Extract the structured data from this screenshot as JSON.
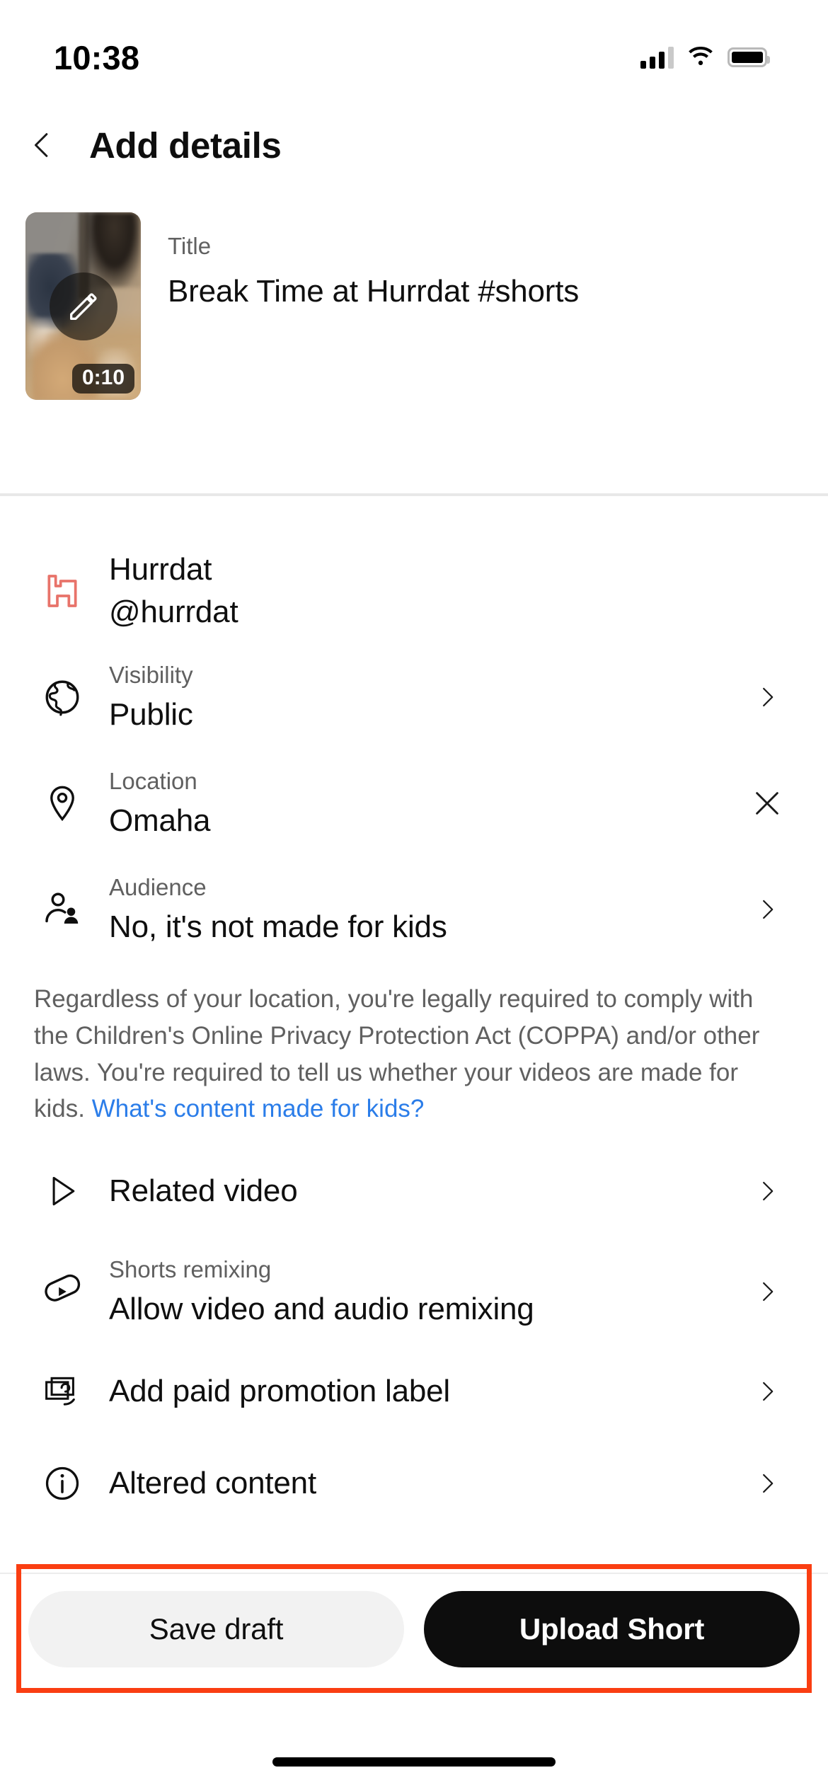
{
  "status_bar": {
    "time": "10:38",
    "signal_icon": "cellular-bars-icon",
    "wifi_icon": "wifi-icon",
    "battery_icon": "battery-icon"
  },
  "header": {
    "back_icon": "back-chevron-icon",
    "title": "Add details"
  },
  "video": {
    "edit_icon": "pencil-edit-icon",
    "duration": "0:10",
    "title_label": "Title",
    "title_value": "Break Time at Hurrdat #shorts"
  },
  "channel": {
    "avatar_icon": "hurrdat-h-logo-icon",
    "name": "Hurrdat",
    "handle": "@hurrdat",
    "brand_color": "#e8736a"
  },
  "rows": {
    "visibility": {
      "icon": "globe-icon",
      "label": "Visibility",
      "value": "Public",
      "action_icon": "chevron-right-icon"
    },
    "location": {
      "icon": "location-pin-icon",
      "label": "Location",
      "value": "Omaha",
      "action_icon": "close-x-icon"
    },
    "audience": {
      "icon": "audience-people-icon",
      "label": "Audience",
      "value": "No, it's not made for kids",
      "action_icon": "chevron-right-icon"
    },
    "related_video": {
      "icon": "play-triangle-icon",
      "value": "Related video",
      "action_icon": "chevron-right-icon"
    },
    "shorts_remixing": {
      "icon": "remix-icon",
      "label": "Shorts remixing",
      "value": "Allow video and audio remixing",
      "action_icon": "chevron-right-icon"
    },
    "paid_promotion": {
      "icon": "paid-promotion-icon",
      "value": "Add paid promotion label",
      "action_icon": "chevron-right-icon"
    },
    "altered_content": {
      "icon": "info-circle-icon",
      "value": "Altered content",
      "action_icon": "chevron-right-icon"
    }
  },
  "disclaimer": {
    "text": "Regardless of your location, you're legally required to comply with the Children's Online Privacy Protection Act (COPPA) and/or other laws. You're required to tell us whether your videos are made for kids. ",
    "link_text": "What's content made for kids?",
    "link_color": "#2b7de9"
  },
  "bottom_bar": {
    "save_draft_label": "Save draft",
    "upload_label": "Upload Short",
    "highlight_color": "#fa3e12"
  }
}
